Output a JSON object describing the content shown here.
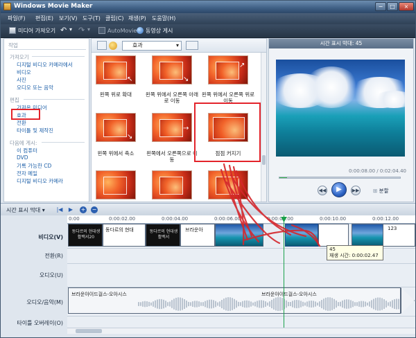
{
  "window": {
    "title": "Windows Movie Maker",
    "minimize": "−",
    "maximize": "□",
    "close": "×"
  },
  "menu": [
    "파일(F)",
    "편집(E)",
    "보기(V)",
    "도구(T)",
    "클립(C)",
    "재생(P)",
    "도움말(H)"
  ],
  "toolbar": {
    "import": "미디어 가져오기",
    "automovie": "AutoMovie",
    "publish": "동영상 게시"
  },
  "tasks": {
    "header": "작업",
    "sections": [
      {
        "title": "가져오기",
        "items": [
          "디지털 비디오 카메라에서",
          "비디오",
          "사진",
          "오디오 또는 음악"
        ]
      },
      {
        "title": "편집",
        "items": [
          "가져온 미디어",
          "효과",
          "전환",
          "타이틀 및 제작진"
        ]
      },
      {
        "title": "다음에 게시:",
        "items": [
          "이 컴퓨터",
          "DVD",
          "기록 가능한 CD",
          "전자 메일",
          "디지털 비디오 카메라"
        ]
      }
    ]
  },
  "collection": {
    "dropdown": "효과",
    "tiles": [
      "왼쪽 위로 확대",
      "왼쪽 위에서 오른쪽 아래로 이동",
      "왼쪽 위에서 오른쪽 위로 이동",
      "왼쪽 위에서 축소",
      "왼쪽에서 오른쪽으로 이동",
      "점점 커지기",
      "",
      "",
      ""
    ]
  },
  "preview": {
    "header": "시간 표시 막대: 45",
    "time": "0:00:08.00 / 0:02:04.40",
    "split": "분할",
    "seek_fraction": 0.064
  },
  "timeline": {
    "label": "시간 표시 막대 ▾",
    "ruler": [
      "0:00",
      "0:00:02.00",
      "0:00:04.00",
      "0:00:06.00",
      "0:00:08.00",
      "0:00:10.00",
      "0:00:12.00"
    ],
    "tracks": [
      "비디오(V)",
      "전환(R)",
      "오디오(U)",
      "오디오/음악(M)",
      "타이틀 오버레이(O)"
    ],
    "clips": [
      "동다르의 현대생활백서20",
      "동다르의 현대",
      "동다르의 현대생활백서",
      "브라운아",
      "",
      "",
      "123"
    ],
    "tooltip": {
      "name": "45",
      "duration": "재생 시간: 0:00:02.47"
    },
    "audio": [
      "브라운아이드걸스-오아시스",
      "브라운아이드걸스-오아시스"
    ]
  }
}
